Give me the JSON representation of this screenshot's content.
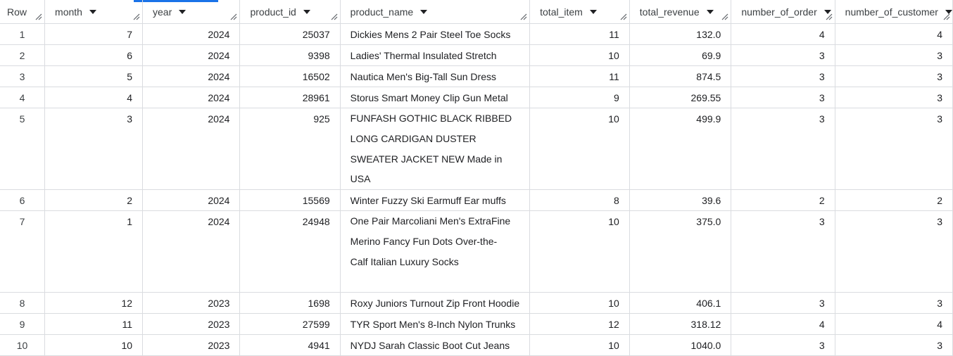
{
  "columns": [
    {
      "label": "Row",
      "width": 67
    },
    {
      "label": "month",
      "width": 148
    },
    {
      "label": "year",
      "width": 149
    },
    {
      "label": "product_id",
      "width": 148
    },
    {
      "label": "product_name",
      "width": 240
    },
    {
      "label": "total_item",
      "width": 148
    },
    {
      "label": "total_revenue",
      "width": 148
    },
    {
      "label": "number_of_order",
      "width": 148
    },
    {
      "label": "number_of_customer",
      "width": 158
    }
  ],
  "rows": [
    {
      "row": "1",
      "month": "7",
      "year": "2024",
      "product_id": "25037",
      "product_name": "Dickies Mens 2 Pair Steel Toe Socks",
      "total_item": "11",
      "total_revenue": "132.0",
      "number_of_order": "4",
      "number_of_customer": "4"
    },
    {
      "row": "2",
      "month": "6",
      "year": "2024",
      "product_id": "9398",
      "product_name": "Ladies' Thermal Insulated Stretch",
      "total_item": "10",
      "total_revenue": "69.9",
      "number_of_order": "3",
      "number_of_customer": "3"
    },
    {
      "row": "3",
      "month": "5",
      "year": "2024",
      "product_id": "16502",
      "product_name": "Nautica Men's Big-Tall Sun Dress",
      "total_item": "11",
      "total_revenue": "874.5",
      "number_of_order": "3",
      "number_of_customer": "3"
    },
    {
      "row": "4",
      "month": "4",
      "year": "2024",
      "product_id": "28961",
      "product_name": "Storus Smart Money Clip Gun Metal",
      "total_item": "9",
      "total_revenue": "269.55",
      "number_of_order": "3",
      "number_of_customer": "3"
    },
    {
      "row": "5",
      "month": "3",
      "year": "2024",
      "product_id": "925",
      "product_name": "FUNFASH GOTHIC BLACK RIBBED LONG CARDIGAN DUSTER SWEATER JACKET NEW Made in USA",
      "total_item": "10",
      "total_revenue": "499.9",
      "number_of_order": "3",
      "number_of_customer": "3",
      "wrap": true
    },
    {
      "row": "6",
      "month": "2",
      "year": "2024",
      "product_id": "15569",
      "product_name": "Winter Fuzzy Ski Earmuff Ear muffs",
      "total_item": "8",
      "total_revenue": "39.6",
      "number_of_order": "2",
      "number_of_customer": "2"
    },
    {
      "row": "7",
      "month": "1",
      "year": "2024",
      "product_id": "24948",
      "product_name": "One Pair Marcoliani Men's ExtraFine Merino Fancy Fun Dots Over-the-Calf Italian Luxury Socks",
      "total_item": "10",
      "total_revenue": "375.0",
      "number_of_order": "3",
      "number_of_customer": "3",
      "wrap": true
    },
    {
      "row": "8",
      "month": "12",
      "year": "2023",
      "product_id": "1698",
      "product_name": "Roxy Juniors Turnout Zip Front Hoodie",
      "total_item": "10",
      "total_revenue": "406.1",
      "number_of_order": "3",
      "number_of_customer": "3"
    },
    {
      "row": "9",
      "month": "11",
      "year": "2023",
      "product_id": "27599",
      "product_name": "TYR Sport Men's 8-Inch Nylon Trunks",
      "total_item": "12",
      "total_revenue": "318.12",
      "number_of_order": "4",
      "number_of_customer": "4"
    },
    {
      "row": "10",
      "month": "10",
      "year": "2023",
      "product_id": "4941",
      "product_name": "NYDJ Sarah Classic Boot Cut Jeans",
      "total_item": "10",
      "total_revenue": "1040.0",
      "number_of_order": "3",
      "number_of_customer": "3"
    }
  ]
}
